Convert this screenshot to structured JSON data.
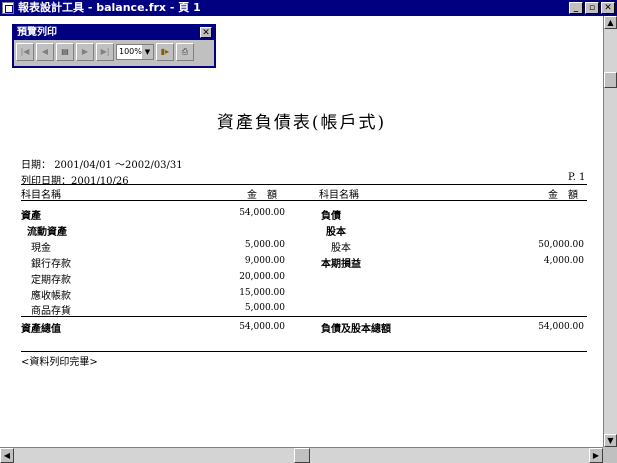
{
  "window": {
    "title": "報表設計工具 - balance.frx - 頁 1"
  },
  "toolbar": {
    "title": "預覽列印",
    "zoom": "100%"
  },
  "report": {
    "title": "資產負債表(帳戶式)",
    "date_label": "日期：",
    "date_range": "2001/04/01 ～2002/03/31",
    "print_date": "列印日期：2001/10/26",
    "page": "P. 1",
    "col_account": "科目名稱",
    "col_amount": "金　額",
    "left_rows": [
      {
        "label": "資產",
        "value": "54,000.00"
      },
      {
        "label": "流動資產",
        "value": ""
      },
      {
        "label": "現金",
        "value": "5,000.00"
      },
      {
        "label": "銀行存款",
        "value": "9,000.00"
      },
      {
        "label": "定期存款",
        "value": "20,000.00"
      },
      {
        "label": "應收帳款",
        "value": "15,000.00"
      },
      {
        "label": "商品存貨",
        "value": "5,000.00"
      }
    ],
    "right_rows": [
      {
        "label": "負債",
        "value": ""
      },
      {
        "label": "股本",
        "value": ""
      },
      {
        "label": "股本",
        "value": "50,000.00"
      },
      {
        "label": "本期損益",
        "value": "4,000.00"
      }
    ],
    "total_left_label": "資產總值",
    "total_left_value": "54,000.00",
    "total_right_label": "負債及股本總額",
    "total_right_value": "54,000.00",
    "end_note": "<資料列印完畢>"
  }
}
